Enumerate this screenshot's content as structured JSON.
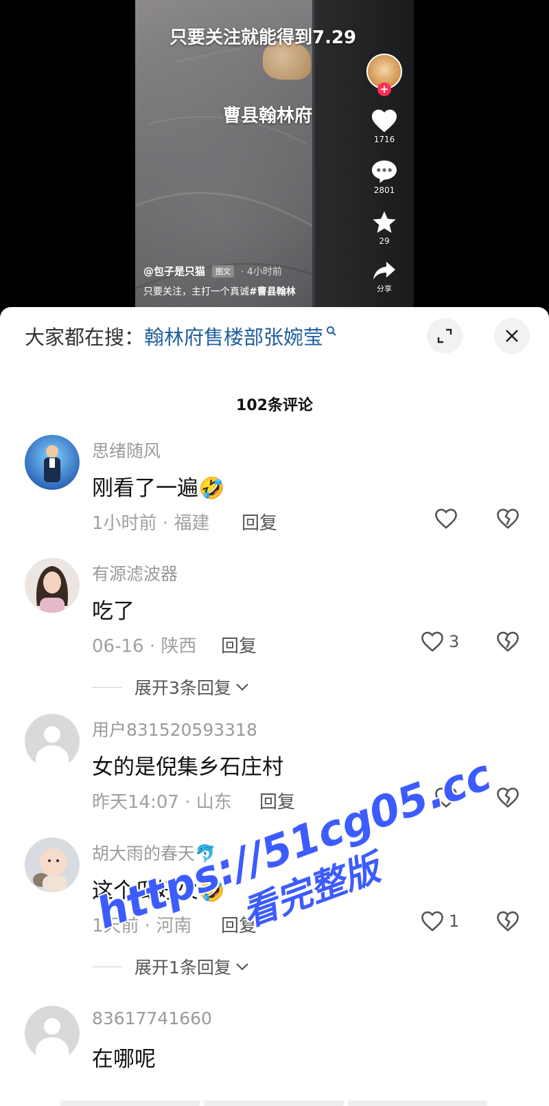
{
  "video": {
    "overlay_title": "只要关注就能得到7.29",
    "overlay_subtitle": "曹县翰林府",
    "author": "@包子是只猫",
    "post_type_badge": "图文",
    "time": "· 4小时前",
    "caption_prefix": "只要关注，主打一个真诚",
    "caption_tag": "#曹县翰林",
    "likes": "1716",
    "comments": "2801",
    "favorites": "29",
    "share_label": "分享"
  },
  "search": {
    "prefix": "大家都在搜：",
    "term": "翰林府售楼部张婉莹"
  },
  "comment_count_label": "102条评论",
  "comments": [
    {
      "name": "思绪随风",
      "text": "刚看了一遍🤣",
      "meta": "1小时前 · 福建",
      "reply_label": "回复",
      "likes": ""
    },
    {
      "name": "有源滤波器",
      "text": "吃了",
      "meta": "06-16 · 陕西",
      "reply_label": "回复",
      "likes": "3",
      "expand_label": "展开3条回复"
    },
    {
      "name": "用户831520593318",
      "text": "女的是倪集乡石庄村",
      "meta": "昨天14:07 · 山东",
      "reply_label": "回复",
      "likes": ""
    },
    {
      "name": "胡大雨的春天🐬",
      "text": "这个瓜好火🤣",
      "meta": "1天前 · 河南",
      "reply_label": "回复",
      "likes": "1",
      "expand_label": "展开1条回复"
    },
    {
      "name": "83617741660",
      "text": "在哪呢"
    }
  ],
  "watermark": {
    "line1": "https://51cg05.cc",
    "line2": "看完整版"
  },
  "colors": {
    "accent_red": "#fe2c55",
    "search_term": "#1f5f9e",
    "watermark": "#3d5cff"
  }
}
